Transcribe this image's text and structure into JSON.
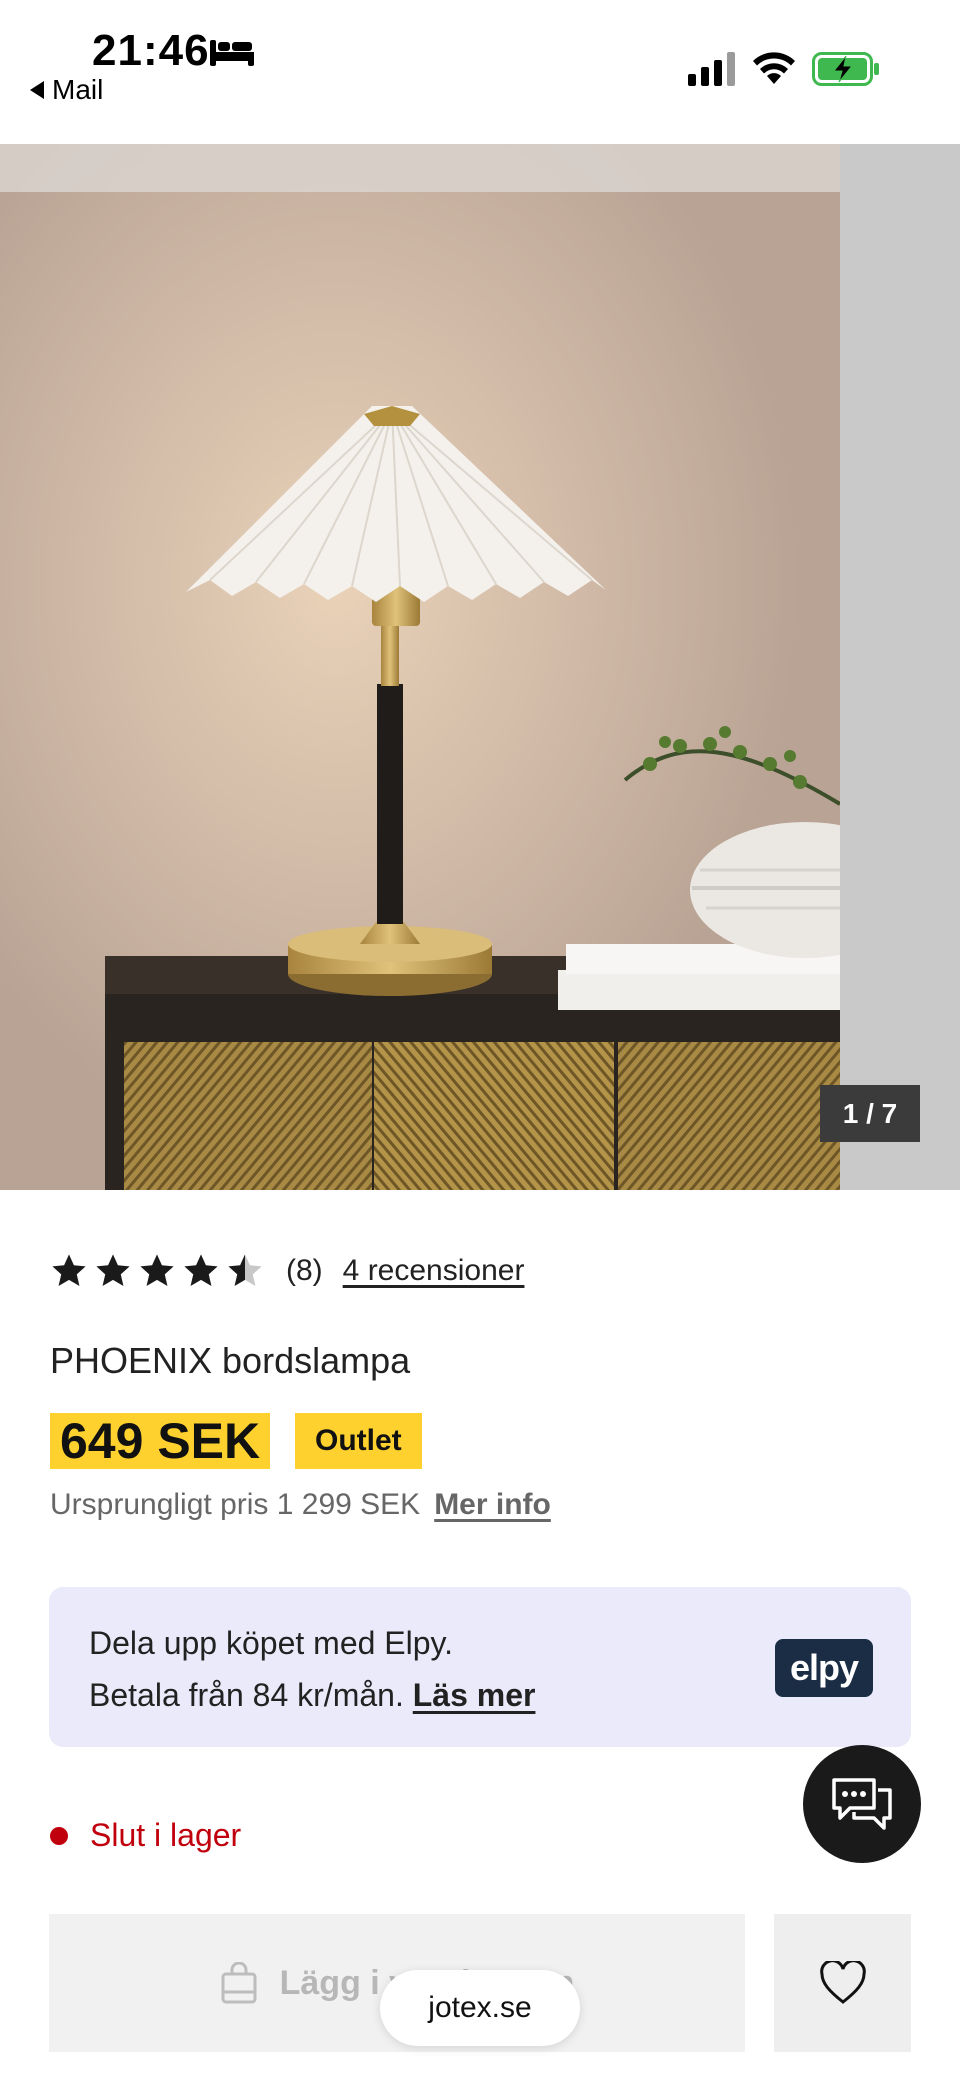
{
  "status_bar": {
    "time": "21:46",
    "back_label": "Mail"
  },
  "gallery": {
    "counter": "1 / 7"
  },
  "product": {
    "rating_stars": 4.5,
    "rating_count": "(8)",
    "reviews_link": "4 recensioner",
    "title": "PHOENIX bordslampa",
    "price": "649 SEK",
    "badge": "Outlet",
    "original_price": "Ursprungligt pris 1 299 SEK",
    "more_info": "Mer info"
  },
  "elpy": {
    "line1": "Dela upp köpet med Elpy.",
    "line2": "Betala från 84 kr/mån.",
    "link": "Läs mer",
    "logo_text": "elpy"
  },
  "stock": {
    "status": "Slut i lager"
  },
  "actions": {
    "add_to_cart": "Lägg i varukorgen"
  },
  "browser": {
    "url": "jotex.se"
  },
  "colors": {
    "accent_yellow": "#ffd12f",
    "out_of_stock_red": "#c0000c",
    "elpy_bg": "#ebeafb",
    "elpy_logo_bg": "#1b2d45"
  }
}
